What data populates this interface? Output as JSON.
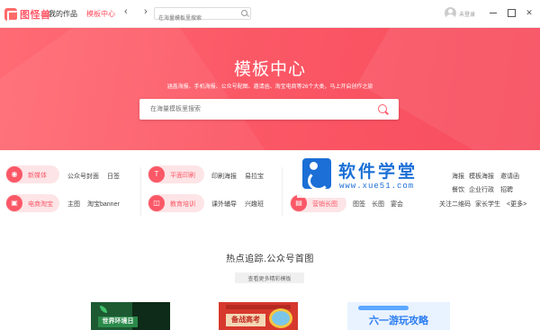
{
  "app": {
    "logo_text": "图怪兽"
  },
  "header": {
    "nav": {
      "works": "我的作品",
      "templates": "模板中心"
    },
    "back_arrow": "‹",
    "forward_arrow": "›",
    "search_placeholder": "在海量模板里搜索",
    "login": "未登录",
    "window": {
      "min": "",
      "max": "",
      "close": "✕"
    }
  },
  "hero": {
    "title": "模板中心",
    "subtitle": "涵盖海报、手机海报、公众号配图、邀请函、淘宝电商等26个大类，马上开启创作之旅",
    "search_placeholder": "在海量模板里搜索"
  },
  "categories": [
    {
      "label": "新媒体",
      "icon": "new-media-icon",
      "glyph": "◉",
      "links": [
        "公众号封面",
        "日签"
      ]
    },
    {
      "label": "平面印刷",
      "icon": "print-icon",
      "glyph": "T",
      "links": [
        "印刷海报",
        "易拉宝"
      ]
    },
    {
      "label": "电商淘宝",
      "icon": "ecommerce-icon",
      "glyph": "▣",
      "links": [
        "主图",
        "淘宝banner"
      ]
    },
    {
      "label": "教育培训",
      "icon": "education-icon",
      "glyph": "◫",
      "links": [
        "课外辅导",
        "兴趣班"
      ]
    },
    {
      "label": "营销长图",
      "icon": "marketing-icon",
      "glyph": "▤",
      "links": [
        "图签",
        "长图",
        "宴会"
      ]
    }
  ],
  "right_links_row1": [
    "海报",
    "模板海报",
    "邀请函"
  ],
  "right_links_row2": [
    "餐饮",
    "企业行政",
    "招聘"
  ],
  "right_links_row3": [
    "关注二维码",
    "家长学生"
  ],
  "more": "<更多>",
  "watermark": {
    "title": "软件学堂",
    "url": "www.xue51.com"
  },
  "hot": {
    "title": "热点追踪.公众号首图",
    "button": "查看更多精彩模板"
  },
  "thumbs": [
    {
      "caption": "世界环境日"
    },
    {
      "caption": "备战高考"
    },
    {
      "caption": "六一游玩攻略"
    }
  ],
  "colors": {
    "brand": "#fb5867",
    "hero_bg": "#f74d5e",
    "watermark_blue": "#1b6fd6"
  }
}
